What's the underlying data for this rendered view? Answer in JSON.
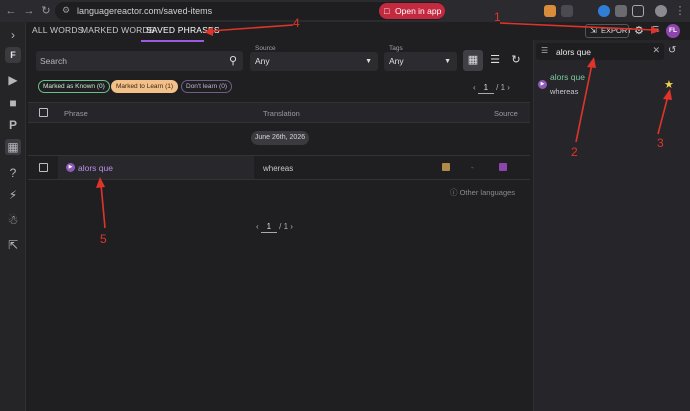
{
  "browser": {
    "url": "languagereactor.com/saved-items",
    "open_in_app": "Open in app"
  },
  "sidebar": {
    "workspace_letter": "F",
    "icons": [
      "chevron-right-icon",
      "puzzle-icon",
      "play-icon",
      "chat-icon",
      "p-icon",
      "saved-items-icon",
      "help-icon",
      "bolt-icon",
      "person-icon",
      "logout-icon"
    ]
  },
  "tabs": [
    {
      "label": "ALL WORDS"
    },
    {
      "label": "MARKED WORDS"
    },
    {
      "label": "SAVED PHRASES",
      "active": true
    }
  ],
  "header": {
    "export_label": "EXPORT",
    "avatar_initials": "FL"
  },
  "filters": {
    "search_placeholder": "Search",
    "source_label": "Source",
    "source_value": "Any",
    "tags_label": "Tags",
    "tags_value": "Any"
  },
  "pills": {
    "known": "Marked as Known (0)",
    "learn": "Marked to Learn (1)",
    "dont": "Don't learn (0)"
  },
  "pager": {
    "page": "1",
    "of": "/ 1"
  },
  "table": {
    "headers": {
      "phrase": "Phrase",
      "translation": "Translation",
      "source": "Source"
    },
    "date_group": "June 26th, 2026",
    "rows": [
      {
        "phrase": "alors que",
        "translation": "whereas",
        "dash": "-"
      }
    ],
    "other_languages": "Other languages"
  },
  "right_panel": {
    "query": "alors que",
    "result_phrase": "alors que",
    "result_translation": "whereas"
  },
  "annotations": [
    "1",
    "2",
    "3",
    "4",
    "5"
  ],
  "colors": {
    "accent": "#9a5be0",
    "annotation": "#e0342a",
    "learn_pill": "#f3c08a",
    "phrase_text": "#b890e8"
  }
}
